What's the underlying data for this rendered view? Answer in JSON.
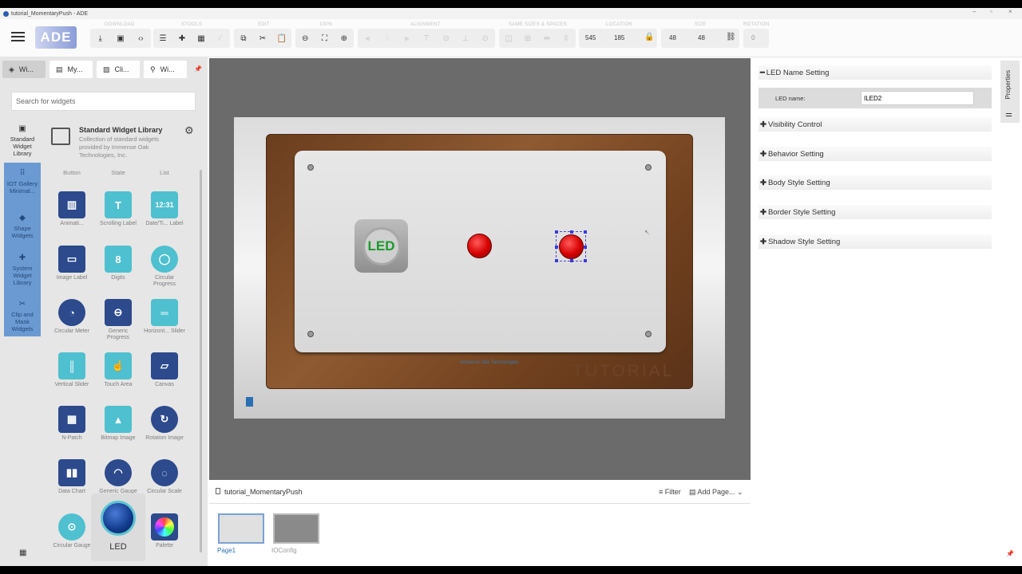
{
  "window": {
    "title": "tutorial_MomentaryPush - ADE"
  },
  "toolbar": {
    "logo": "ADE",
    "groups": [
      "DOWNLOAD",
      "STOOLS",
      "EDIT",
      "100%",
      "ALIGNMENT",
      "SAME SIZES & SPACES",
      "LOCATION",
      "SIZE",
      "ROTATION"
    ],
    "location_x": "545",
    "location_y": "185",
    "size_w": "48",
    "size_h": "48",
    "rotation": "0"
  },
  "left": {
    "tabs": [
      "Wi...",
      "My...",
      "Cli...",
      "Wi..."
    ],
    "search_placeholder": "Search for widgets",
    "categories": [
      "Standard Widget Library",
      "IOT Gallery Minimal...",
      "Shape Widgets",
      "System Widget Library",
      "Clip and Mask Widgets"
    ],
    "library": {
      "title": "Standard Widget Library",
      "description": "Collection of standard widgets provided by Immense Oak Technologies, Inc."
    },
    "column_headers": [
      "Button",
      "State",
      "List"
    ],
    "widgets": [
      "Animati...",
      "Scrolling Label",
      "Date/Ti... Label",
      "Image Label",
      "Digits",
      "Circular Progress",
      "Circular Meter",
      "Generic Progress",
      "Horizont... Slider",
      "Vertical Slider",
      "Touch Area",
      "Canvas",
      "N-Patch",
      "Bitmap Image",
      "Rotation Image",
      "Data Chart",
      "Generic Gauge",
      "Circular Scale",
      "Circular Gauge",
      "LED",
      "Palette"
    ]
  },
  "canvas": {
    "led_button_text": "LED",
    "brand_text": "Immense Oak Technologies",
    "watermark": "TUTORIAL"
  },
  "pages": {
    "project": "tutorial_MomentaryPush",
    "filter": "Filter",
    "add_page": "Add Page...",
    "items": [
      "Page1",
      "IOConfig"
    ]
  },
  "properties": {
    "tab": "Properties",
    "sections": [
      "LED Name Setting",
      "Visibility Control",
      "Behavior Setting",
      "Body Style Setting",
      "Border Style Setting",
      "Shadow Style Setting"
    ],
    "led_name_label": "LED name:",
    "led_name_value": "ILED2"
  },
  "colors": {
    "accent": "#4fc0cf",
    "navy": "#2c4a8c",
    "category_bg": "#6b9ad3",
    "led_red": "#d60000"
  }
}
